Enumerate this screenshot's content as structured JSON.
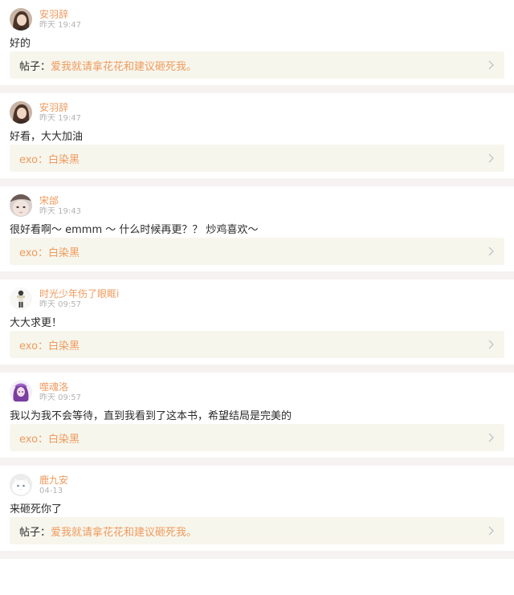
{
  "comments": [
    {
      "name": "安羽辞",
      "time": "昨天 19:47",
      "content": "好的",
      "ref_prefix": "帖子：",
      "ref_prefix_color": "#2b2b2b",
      "ref_title": "爱我就请拿花花和建议砸死我。",
      "avatar_icon": "girl-photo-avatar"
    },
    {
      "name": "安羽辞",
      "time": "昨天 19:47",
      "content": "好看，大大加油",
      "ref_prefix": "exo：",
      "ref_prefix_color": "#ef9a5c",
      "ref_title": "白染黑",
      "avatar_icon": "girl-photo-avatar"
    },
    {
      "name": "宋邰",
      "time": "昨天 19:43",
      "content": "很好看啊～ emmm ～ 什么时候再更？？ 炒鸡喜欢～",
      "ref_prefix": "exo：",
      "ref_prefix_color": "#ef9a5c",
      "ref_title": "白染黑",
      "avatar_icon": "face-closeup-avatar"
    },
    {
      "name": "时光少年伤了眼眶i",
      "time": "昨天 09:57",
      "content": "大大求更！",
      "ref_prefix": "exo：",
      "ref_prefix_color": "#ef9a5c",
      "ref_title": "白染黑",
      "avatar_icon": "standing-figure-avatar"
    },
    {
      "name": "噬魂洛",
      "time": "昨天 09:57",
      "content": "我以为我不会等待，直到我看到了这本书，希望结局是完美的",
      "ref_prefix": "exo：",
      "ref_prefix_color": "#ef9a5c",
      "ref_title": "白染黑",
      "avatar_icon": "purple-anime-avatar"
    },
    {
      "name": "鹿九安",
      "time": "04-13",
      "content": "来砸死你了",
      "ref_prefix": "帖子：",
      "ref_prefix_color": "#2b2b2b",
      "ref_title": "爱我就请拿花花和建议砸死我。",
      "avatar_icon": "white-cat-avatar"
    }
  ],
  "colors": {
    "accent": "#ef9a5c",
    "text": "#2b2b2b",
    "muted": "#b3b3b3",
    "ref_bg": "#f7f6ed",
    "separator": "#f6f2f2"
  }
}
